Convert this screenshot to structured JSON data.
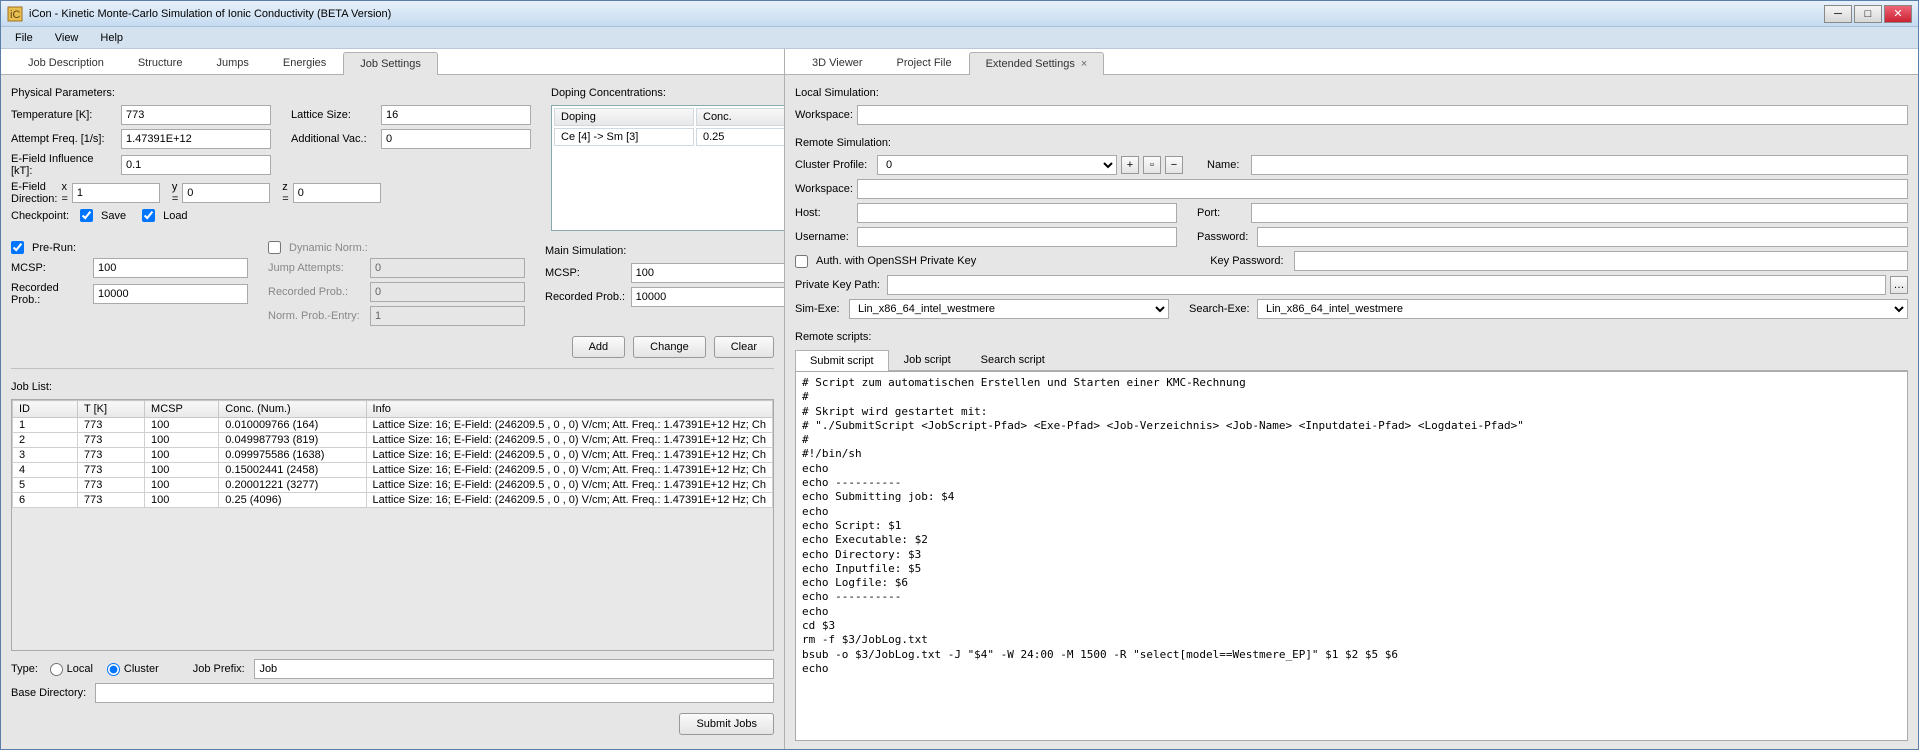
{
  "window": {
    "title": "iCon - Kinetic Monte-Carlo Simulation of Ionic Conductivity (BETA Version)"
  },
  "menubar": [
    "File",
    "View",
    "Help"
  ],
  "left_tabs": [
    "Job Description",
    "Structure",
    "Jumps",
    "Energies",
    "Job Settings"
  ],
  "left_tab_active": 4,
  "right_tabs": [
    "3D Viewer",
    "Project File",
    "Extended Settings"
  ],
  "right_tab_active": 2,
  "phys": {
    "heading": "Physical Parameters:",
    "temp_label": "Temperature [K]:",
    "temp": "773",
    "attfreq_label": "Attempt Freq. [1/s]:",
    "attfreq": "1.47391E+12",
    "efinf_label": "E-Field Influence [kT]:",
    "efinf": "0.1",
    "efdir_label": "E-Field Direction:",
    "efdir_x_lbl": "x =",
    "efdir_x": "1",
    "efdir_y_lbl": "y =",
    "efdir_y": "0",
    "efdir_z_lbl": "z =",
    "efdir_z": "0",
    "lattice_label": "Lattice Size:",
    "lattice": "16",
    "addvac_label": "Additional Vac.:",
    "addvac": "0",
    "checkpoint_label": "Checkpoint:",
    "save_label": "Save",
    "load_label": "Load"
  },
  "doping": {
    "heading": "Doping Concentrations:",
    "col1": "Doping",
    "col2": "Conc.",
    "row1_doping": "Ce [4] -> Sm [3]",
    "row1_conc": "0.25"
  },
  "prerun": {
    "label": "Pre-Run:",
    "mcsp_label": "MCSP:",
    "mcsp": "100",
    "recp_label": "Recorded Prob.:",
    "recp": "10000"
  },
  "dynnorm": {
    "label": "Dynamic Norm.:",
    "ja_label": "Jump Attempts:",
    "ja": "0",
    "rp_label": "Recorded Prob.:",
    "rp": "0",
    "npe_label": "Norm. Prob.-Entry:",
    "npe": "1"
  },
  "mainsim": {
    "heading": "Main Simulation:",
    "mcsp_label": "MCSP:",
    "mcsp": "100",
    "recp_label": "Recorded Prob.:",
    "recp": "10000"
  },
  "buttons": {
    "add": "Add",
    "change": "Change",
    "clear": "Clear",
    "submit": "Submit Jobs"
  },
  "joblist": {
    "heading": "Job List:",
    "cols": [
      "ID",
      "T [K]",
      "MCSP",
      "Conc. (Num.)",
      "Info"
    ],
    "rows": [
      [
        "1",
        "773",
        "100",
        "0.010009766 (164)",
        "Lattice Size: 16; E-Field: (246209.5 , 0 , 0) V/cm; Att. Freq.: 1.47391E+12 Hz; Ch"
      ],
      [
        "2",
        "773",
        "100",
        "0.049987793 (819)",
        "Lattice Size: 16; E-Field: (246209.5 , 0 , 0) V/cm; Att. Freq.: 1.47391E+12 Hz; Ch"
      ],
      [
        "3",
        "773",
        "100",
        "0.099975586 (1638)",
        "Lattice Size: 16; E-Field: (246209.5 , 0 , 0) V/cm; Att. Freq.: 1.47391E+12 Hz; Ch"
      ],
      [
        "4",
        "773",
        "100",
        "0.15002441 (2458)",
        "Lattice Size: 16; E-Field: (246209.5 , 0 , 0) V/cm; Att. Freq.: 1.47391E+12 Hz; Ch"
      ],
      [
        "5",
        "773",
        "100",
        "0.20001221 (3277)",
        "Lattice Size: 16; E-Field: (246209.5 , 0 , 0) V/cm; Att. Freq.: 1.47391E+12 Hz; Ch"
      ],
      [
        "6",
        "773",
        "100",
        "0.25 (4096)",
        "Lattice Size: 16; E-Field: (246209.5 , 0 , 0) V/cm; Att. Freq.: 1.47391E+12 Hz; Ch"
      ]
    ]
  },
  "jobfooter": {
    "type_label": "Type:",
    "local_label": "Local",
    "cluster_label": "Cluster",
    "prefix_label": "Job Prefix:",
    "prefix": "Job",
    "basedir_label": "Base Directory:"
  },
  "ext": {
    "local_heading": "Local Simulation:",
    "remote_heading": "Remote Simulation:",
    "workspace_label": "Workspace:",
    "cluster_profile_label": "Cluster Profile:",
    "cluster_profile": "0",
    "name_label": "Name:",
    "host_label": "Host:",
    "port_label": "Port:",
    "user_label": "Username:",
    "pass_label": "Password:",
    "openssh_label": "Auth. with OpenSSH Private Key",
    "keypass_label": "Key Password:",
    "pkpath_label": "Private Key Path:",
    "simexe_label": "Sim-Exe:",
    "simexe": "Lin_x86_64_intel_westmere",
    "searchexe_label": "Search-Exe:",
    "searchexe": "Lin_x86_64_intel_westmere",
    "scripts_heading": "Remote scripts:",
    "script_tabs": [
      "Submit script",
      "Job script",
      "Search script"
    ],
    "script": "# Script zum automatischen Erstellen und Starten einer KMC-Rechnung\n#\n# Skript wird gestartet mit:\n# \"./SubmitScript <JobScript-Pfad> <Exe-Pfad> <Job-Verzeichnis> <Job-Name> <Inputdatei-Pfad> <Logdatei-Pfad>\"\n#\n#!/bin/sh\necho\necho ----------\necho Submitting job: $4\necho\necho Script: $1\necho Executable: $2\necho Directory: $3\necho Inputfile: $5\necho Logfile: $6\necho ----------\necho\ncd $3\nrm -f $3/JobLog.txt\nbsub -o $3/JobLog.txt -J \"$4\" -W 24:00 -M 1500 -R \"select[model==Westmere_EP]\" $1 $2 $5 $6\necho"
  }
}
